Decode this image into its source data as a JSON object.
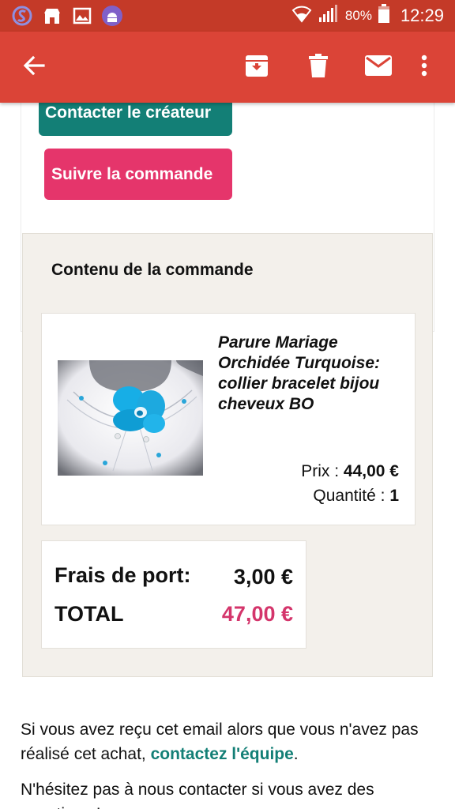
{
  "status_bar": {
    "battery_percent": "80%",
    "time": "12:29",
    "icons": [
      "app-s-icon",
      "store-icon",
      "image-icon",
      "android-icon",
      "wifi-icon",
      "signal-icon",
      "battery-icon"
    ]
  },
  "app_bar": {
    "icons": [
      "back-arrow-icon",
      "archive-icon",
      "delete-icon",
      "mark-unread-icon",
      "more-vert-icon"
    ]
  },
  "buttons": {
    "contact_creator": "Contacter le créateur",
    "follow_order": "Suivre la commande"
  },
  "order": {
    "title": "Contenu de la commande",
    "product": {
      "name": "Parure Mariage Orchidée Turquoise: collier bracelet bijou cheveux BO",
      "price_label": "Prix : ",
      "price": "44,00 €",
      "quantity_label": "Quantité : ",
      "quantity": "1"
    },
    "shipping_label": "Frais de port:",
    "shipping_value": "3,00 €",
    "total_label": "TOTAL",
    "total_value": "47,00 €"
  },
  "footer": {
    "line1_before": "Si vous avez reçu cet email alors que vous n'avez pas réalisé cet achat, ",
    "line1_link": "contactez l'équipe",
    "line1_after": ".",
    "line2": "N'hésitez pas à nous contacter si vous avez des questions !"
  },
  "colors": {
    "status_bar": "#c43a28",
    "app_bar": "#db4437",
    "teal": "#137f76",
    "pink": "#e5356b",
    "total_pink": "#d4356b",
    "section_bg": "#f3f0eb"
  }
}
